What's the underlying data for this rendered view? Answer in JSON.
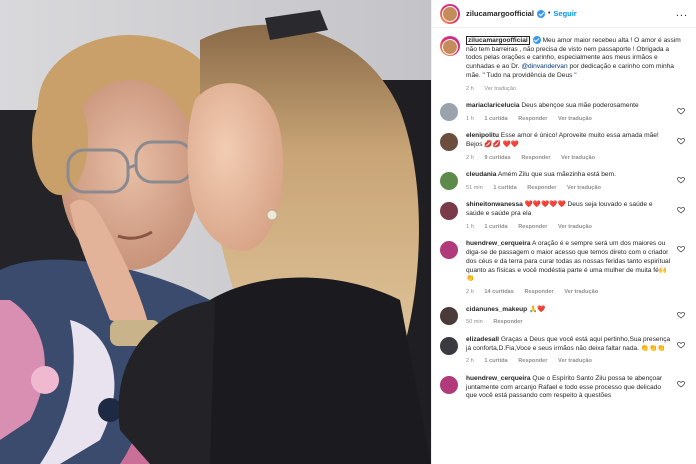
{
  "header": {
    "username": "zilucamargoofficial",
    "separator": "•",
    "follow_label": "Seguir",
    "more_label": "..."
  },
  "caption": {
    "username": "zilucamargoofficial",
    "text_a": " Meu amor maior recebeu alta ! O amor é assim não tem barreiras , não precisa de visto nem passaporte ! Obrigada a todos pelas orações e carinho, especialmente aos meus irmãos e cunhadas e ao Dr. ",
    "mention": "@dinvandervan",
    "text_b": " por dedicação e carinho com minha mãe. \" Tudo na providência de Deus \"",
    "time": "2 h",
    "translate": "Ver tradução"
  },
  "comments": [
    {
      "username": "mariaclaricelucia",
      "text": " Deus abençoe sua mãe poderosamente",
      "time": "1 h",
      "likes": "1 curtida",
      "reply": "Responder",
      "translate": "Ver tradução",
      "avatar_color": "#9aa3ad"
    },
    {
      "username": "elenipolitu",
      "text": " Esse amor é único! Aproveite muito essa amada mãe! Bejos 💋💋 ❤️❤️",
      "time": "2 h",
      "likes": "9 curtidas",
      "reply": "Responder",
      "translate": "Ver tradução",
      "avatar_color": "#6b4e3d"
    },
    {
      "username": "cleudania",
      "text": " Amém Zilu que sua mãezinha está bem.",
      "time": "51 min",
      "likes": "1 curtida",
      "reply": "Responder",
      "translate": "Ver tradução",
      "avatar_color": "#5c8a4a"
    },
    {
      "username": "shineitonwanessa",
      "text": " ❤️❤️❤️❤️❤️ Deus seja louvado e saúde e saúde e saúde pra ela",
      "time": "1 h",
      "likes": "1 curtida",
      "reply": "Responder",
      "translate": "Ver tradução",
      "avatar_color": "#7a3a4a"
    },
    {
      "username": "huendrew_cerqueira",
      "text": " A oração é e sempre será um dos maiores ou diga-se de passagem o maior acesso que temos direto com o criador dos céus e da terra para curar todas as nossas feridas tanto espiritual quanto as físicas e você modéstia parte é uma mulher de muita fé🙌👏",
      "time": "2 h",
      "likes": "14 curtidas",
      "reply": "Responder",
      "translate": "Ver tradução",
      "avatar_color": "#b03a7a"
    },
    {
      "username": "cidanunes_makeup",
      "text": " 🙏❤️",
      "time": "50 min",
      "likes": "",
      "reply": "Responder",
      "translate": "",
      "avatar_color": "#4a3a3a"
    },
    {
      "username": "elizadesall",
      "text": " Graças a Deus que você está aqui pertinho,Sua presença já conforta,D.Fia,Voce e seus irmãos não deixa faltar nada. 👏👏👏",
      "time": "2 h",
      "likes": "1 curtida",
      "reply": "Responder",
      "translate": "Ver tradução",
      "avatar_color": "#3a3a40"
    },
    {
      "username": "huendrew_cerqueira",
      "text": " Que o Espírito Santo Zilu possa te abençoar juntamente com arcanjo Rafael e todo esse processo que delicado que você está passando com respeito à questões",
      "time": "",
      "likes": "",
      "reply": "",
      "translate": "",
      "avatar_color": "#b03a7a"
    }
  ],
  "colors": {
    "accent": "#0095f6",
    "mention": "#00376b",
    "muted": "#8e8e8e",
    "verified": "#3897f0"
  },
  "icons": {
    "verified": "verified-badge-icon",
    "more": "more-options-icon",
    "like": "heart-outline-icon"
  }
}
